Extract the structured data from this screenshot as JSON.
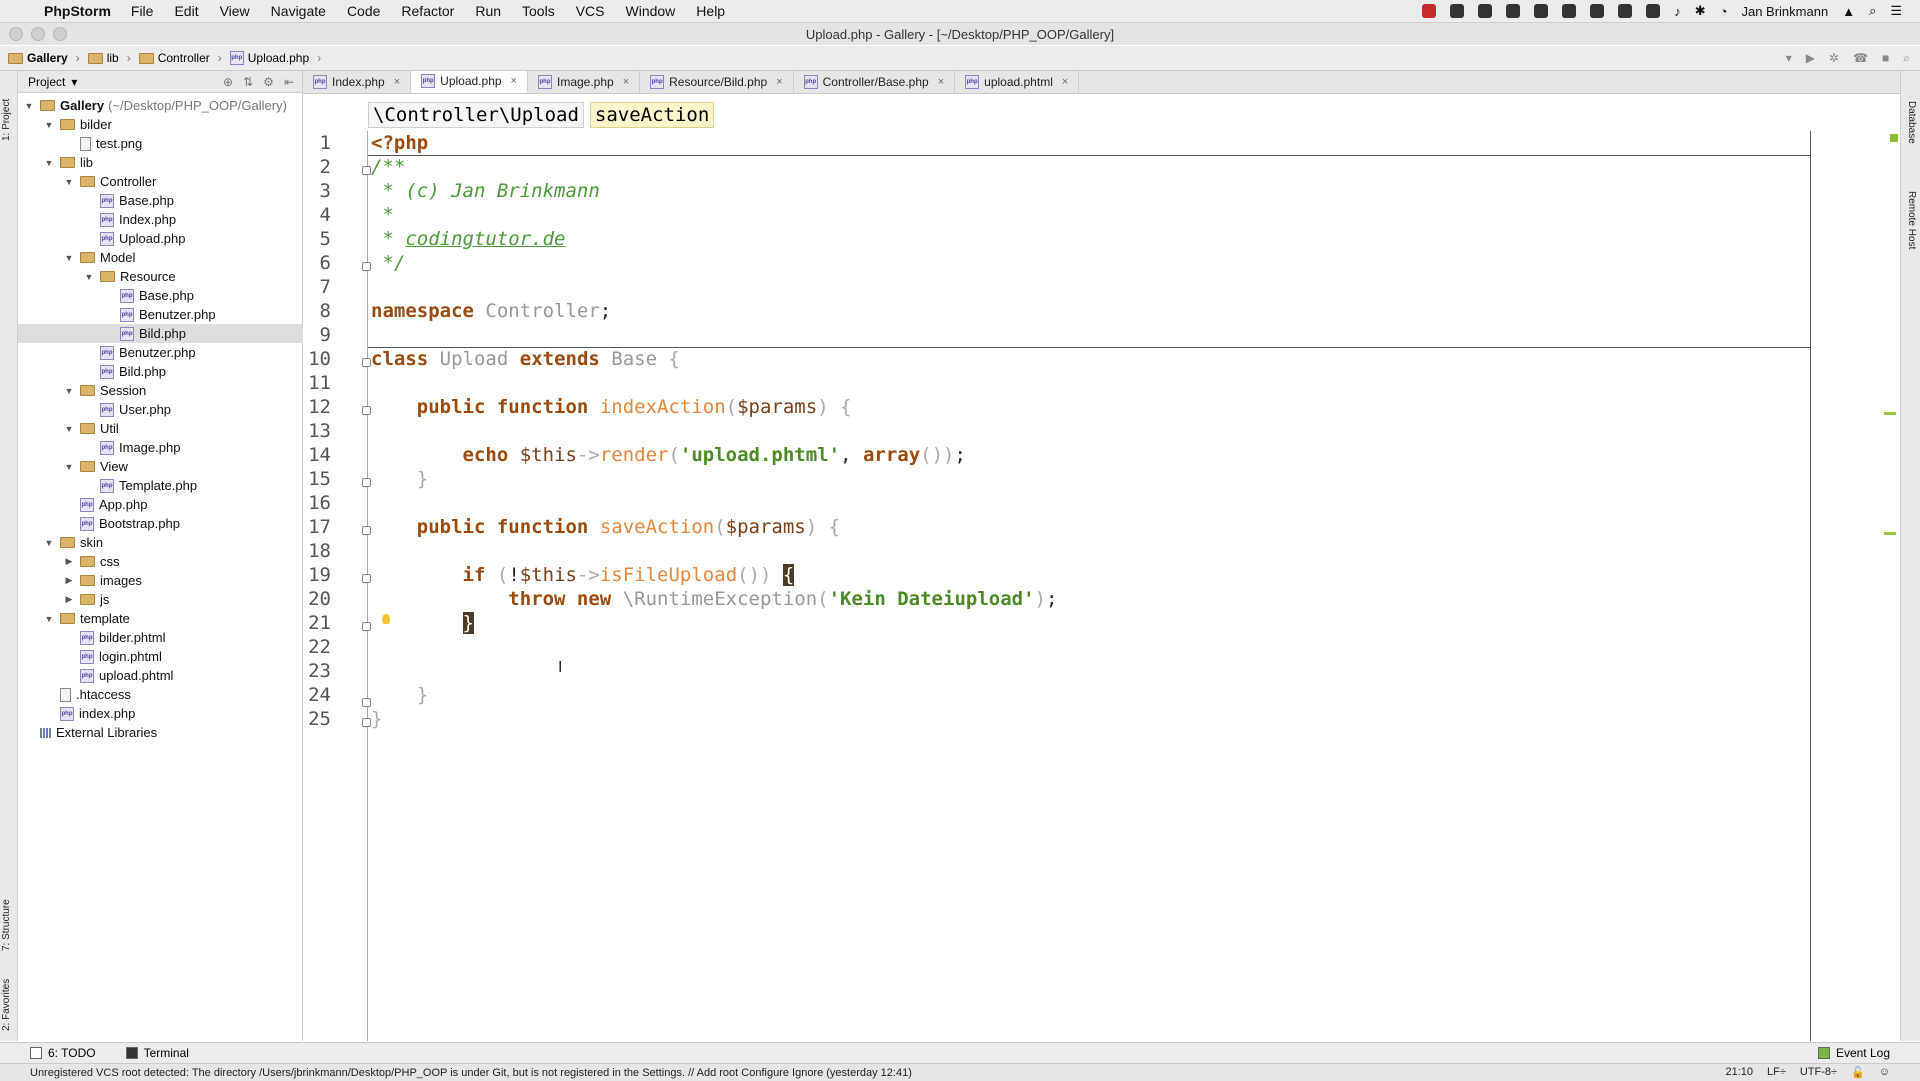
{
  "menubar": {
    "app_name": "PhpStorm",
    "items": [
      "File",
      "Edit",
      "View",
      "Navigate",
      "Code",
      "Refactor",
      "Run",
      "Tools",
      "VCS",
      "Window",
      "Help"
    ],
    "user": "Jan Brinkmann"
  },
  "window": {
    "title": "Upload.php - Gallery - [~/Desktop/PHP_OOP/Gallery]"
  },
  "navbar": {
    "breadcrumb": [
      "Gallery",
      "lib",
      "Controller",
      "Upload.php"
    ]
  },
  "project_panel": {
    "header": "Project",
    "root_label": "Gallery",
    "root_path": "(~/Desktop/PHP_OOP/Gallery)",
    "tree": [
      {
        "label": "bilder",
        "type": "folder",
        "depth": 1,
        "open": true
      },
      {
        "label": "test.png",
        "type": "image",
        "depth": 2
      },
      {
        "label": "lib",
        "type": "folder",
        "depth": 1,
        "open": true
      },
      {
        "label": "Controller",
        "type": "folder",
        "depth": 2,
        "open": true
      },
      {
        "label": "Base.php",
        "type": "php",
        "depth": 3
      },
      {
        "label": "Index.php",
        "type": "php",
        "depth": 3
      },
      {
        "label": "Upload.php",
        "type": "php",
        "depth": 3
      },
      {
        "label": "Model",
        "type": "folder",
        "depth": 2,
        "open": true
      },
      {
        "label": "Resource",
        "type": "folder",
        "depth": 3,
        "open": true
      },
      {
        "label": "Base.php",
        "type": "php",
        "depth": 4
      },
      {
        "label": "Benutzer.php",
        "type": "php",
        "depth": 4
      },
      {
        "label": "Bild.php",
        "type": "php",
        "depth": 4,
        "selected": true
      },
      {
        "label": "Benutzer.php",
        "type": "php",
        "depth": 3
      },
      {
        "label": "Bild.php",
        "type": "php",
        "depth": 3
      },
      {
        "label": "Session",
        "type": "folder",
        "depth": 2,
        "open": true
      },
      {
        "label": "User.php",
        "type": "php",
        "depth": 3
      },
      {
        "label": "Util",
        "type": "folder",
        "depth": 2,
        "open": true
      },
      {
        "label": "Image.php",
        "type": "php",
        "depth": 3
      },
      {
        "label": "View",
        "type": "folder",
        "depth": 2,
        "open": true
      },
      {
        "label": "Template.php",
        "type": "php",
        "depth": 3
      },
      {
        "label": "App.php",
        "type": "php",
        "depth": 2
      },
      {
        "label": "Bootstrap.php",
        "type": "php",
        "depth": 2
      },
      {
        "label": "skin",
        "type": "folder",
        "depth": 1,
        "open": true
      },
      {
        "label": "css",
        "type": "folder",
        "depth": 2,
        "open": false
      },
      {
        "label": "images",
        "type": "folder",
        "depth": 2,
        "open": false
      },
      {
        "label": "js",
        "type": "folder",
        "depth": 2,
        "open": false
      },
      {
        "label": "template",
        "type": "folder",
        "depth": 1,
        "open": true
      },
      {
        "label": "bilder.phtml",
        "type": "php",
        "depth": 2
      },
      {
        "label": "login.phtml",
        "type": "php",
        "depth": 2
      },
      {
        "label": "upload.phtml",
        "type": "php",
        "depth": 2
      },
      {
        "label": ".htaccess",
        "type": "file",
        "depth": 1
      },
      {
        "label": "index.php",
        "type": "php",
        "depth": 1
      },
      {
        "label": "External Libraries",
        "type": "ext",
        "depth": 0
      }
    ]
  },
  "tabs": [
    {
      "label": "Index.php",
      "active": false
    },
    {
      "label": "Upload.php",
      "active": true
    },
    {
      "label": "Image.php",
      "active": false
    },
    {
      "label": "Resource/Bild.php",
      "active": false
    },
    {
      "label": "Controller/Base.php",
      "active": false
    },
    {
      "label": "upload.phtml",
      "active": false
    }
  ],
  "editor": {
    "breadcrumb": [
      "\\Controller\\Upload",
      "saveAction"
    ],
    "line_numbers": [
      "1",
      "2",
      "3",
      "4",
      "5",
      "6",
      "7",
      "8",
      "9",
      "10",
      "11",
      "12",
      "13",
      "14",
      "15",
      "16",
      "17",
      "18",
      "19",
      "20",
      "21",
      "22",
      "23",
      "24",
      "25"
    ]
  },
  "side_tabs": {
    "left": [
      "1: Project",
      "7: Structure",
      "2: Favorites"
    ],
    "right": [
      "Database",
      "Remote Host"
    ]
  },
  "bottom_tabs": [
    "6: TODO",
    "Terminal"
  ],
  "event_log": "Event Log",
  "status": {
    "message": "Unregistered VCS root detected: The directory /Users/jbrinkmann/Desktop/PHP_OOP is under Git, but is not registered in the Settings. // Add root  Configure  Ignore (yesterday 12:41)",
    "position": "21:10",
    "line_sep": "LF÷",
    "encoding": "UTF-8÷"
  }
}
